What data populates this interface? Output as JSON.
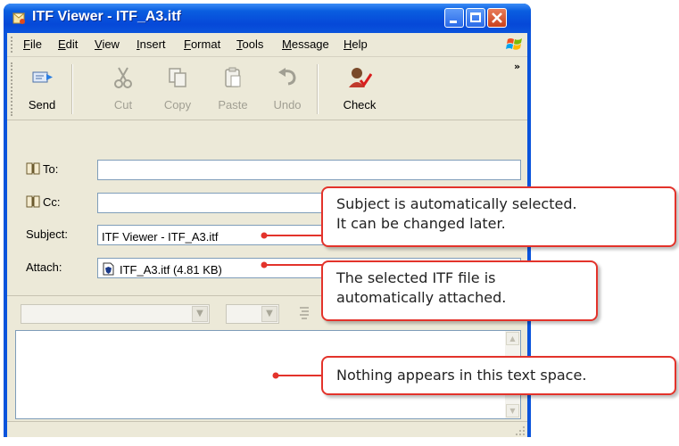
{
  "window": {
    "title": "ITF Viewer - ITF_A3.itf"
  },
  "menu": [
    "File",
    "Edit",
    "View",
    "Insert",
    "Format",
    "Tools",
    "Message",
    "Help"
  ],
  "toolbar": {
    "send": "Send",
    "cut": "Cut",
    "copy": "Copy",
    "paste": "Paste",
    "undo": "Undo",
    "check": "Check"
  },
  "header": {
    "to_label": "To:",
    "to_value": "",
    "cc_label": "Cc:",
    "cc_value": "",
    "subject_label": "Subject:",
    "subject_value": "ITF Viewer - ITF_A3.itf",
    "attach_label": "Attach:",
    "attach_value": "ITF_A3.itf (4.81 KB)"
  },
  "body": {
    "text": ""
  },
  "callouts": {
    "subject": {
      "line1": "Subject is automatically selected.",
      "line2": "It can be changed later."
    },
    "attach": {
      "line1": "The selected ITF file is",
      "line2": "automatically attached."
    },
    "body": {
      "line1": "Nothing appears in this text space."
    }
  },
  "colors": {
    "titlebar": "#0a54dc",
    "callout_border": "#e3332b",
    "chrome": "#ece9d8"
  }
}
